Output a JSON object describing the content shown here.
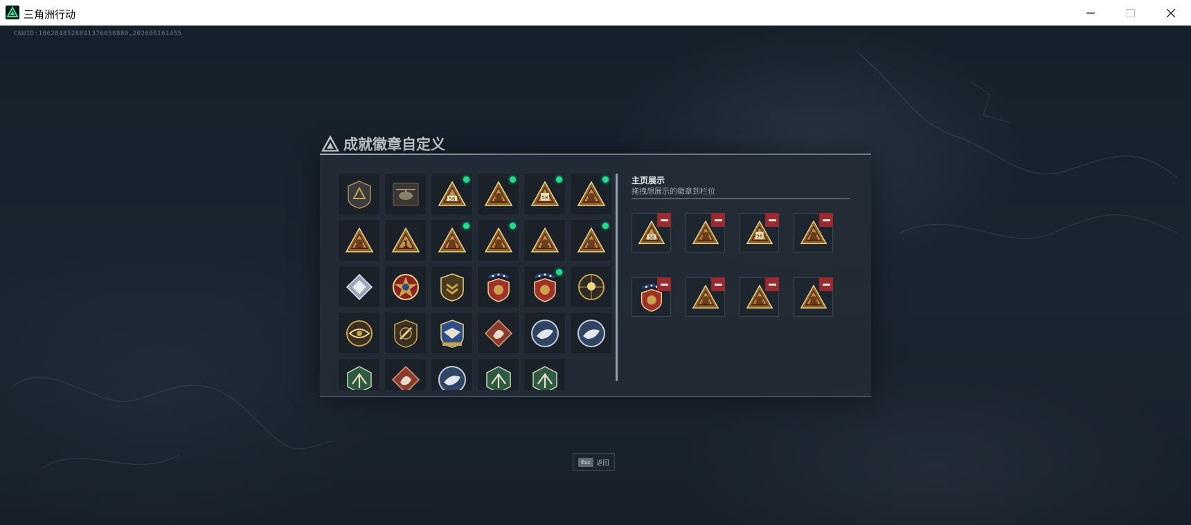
{
  "window": {
    "title": "三角洲行动",
    "controls": [
      "minimize-icon",
      "maximize-icon",
      "close-icon"
    ]
  },
  "uid": "CNUID:1062848528841376058880,202606161455",
  "dialog": {
    "title": "成就徽章自定义",
    "title_icon": "delta-logo-icon"
  },
  "badges": [
    {
      "icon": "gray-shield-delta-badge",
      "new": false
    },
    {
      "icon": "helicopter-badge",
      "new": false
    },
    {
      "icon": "gold-triangle-56-badge",
      "new": true
    },
    {
      "icon": "gold-triangle-tower-badge",
      "new": true
    },
    {
      "icon": "gold-triangle-58-badge",
      "new": true
    },
    {
      "icon": "gold-triangle-soldier-badge",
      "new": true
    },
    {
      "icon": "gold-triangle-helmet-badge",
      "new": false
    },
    {
      "icon": "gold-triangle-one-badge",
      "new": false
    },
    {
      "icon": "gold-triangle-sniper-badge",
      "new": true
    },
    {
      "icon": "gold-triangle-emblem-badge",
      "new": true
    },
    {
      "icon": "gold-triangle-squad-badge",
      "new": false
    },
    {
      "icon": "gold-triangle-squad2-badge",
      "new": true
    },
    {
      "icon": "silver-diamond-badge",
      "new": false
    },
    {
      "icon": "red-star-medal-badge",
      "new": false
    },
    {
      "icon": "gold-shield-chevron-badge",
      "new": false
    },
    {
      "icon": "red-shield-stars-badge",
      "new": false
    },
    {
      "icon": "red-shield-stars2-badge",
      "new": true
    },
    {
      "icon": "gold-skull-target-badge",
      "new": false
    },
    {
      "icon": "gold-eye-badge",
      "new": false
    },
    {
      "icon": "gold-shield-slash-badge",
      "new": false
    },
    {
      "icon": "blue-eagle-crest-badge",
      "new": false
    },
    {
      "icon": "red-diamond-wolf-badge",
      "new": false
    },
    {
      "icon": "blue-round-eagle-badge",
      "new": false
    },
    {
      "icon": "blue-round-eagle2-badge",
      "new": false
    },
    {
      "icon": "green-hex-eagle-badge",
      "new": false
    },
    {
      "icon": "red-diamond-dragon-badge",
      "new": false
    },
    {
      "icon": "blue-round-wolf-badge",
      "new": false
    },
    {
      "icon": "green-hex-dragonfly-badge",
      "new": false
    },
    {
      "icon": "green-hex-dragonfly2-badge",
      "new": false
    }
  ],
  "showcase": {
    "title": "主页展示",
    "subtitle": "拖拽想展示的徽章到栏位",
    "slots": [
      {
        "icon": "gold-triangle-56-badge"
      },
      {
        "icon": "gold-triangle-tower-badge"
      },
      {
        "icon": "gold-triangle-58-badge"
      },
      {
        "icon": "gold-triangle-soldier-badge"
      },
      {
        "icon": "red-shield-stars2-badge"
      },
      {
        "icon": "gold-triangle-squad2-badge"
      },
      {
        "icon": "gold-triangle-emblem-badge"
      },
      {
        "icon": "gold-triangle-sniper-badge"
      }
    ]
  },
  "footer": {
    "esc_key": "Esc",
    "esc_label": "返回"
  },
  "colors": {
    "accent_green": "#1fe08a",
    "remove_red": "#9a2a2e",
    "gold": "#c9a24a",
    "panel": "#232c36"
  }
}
